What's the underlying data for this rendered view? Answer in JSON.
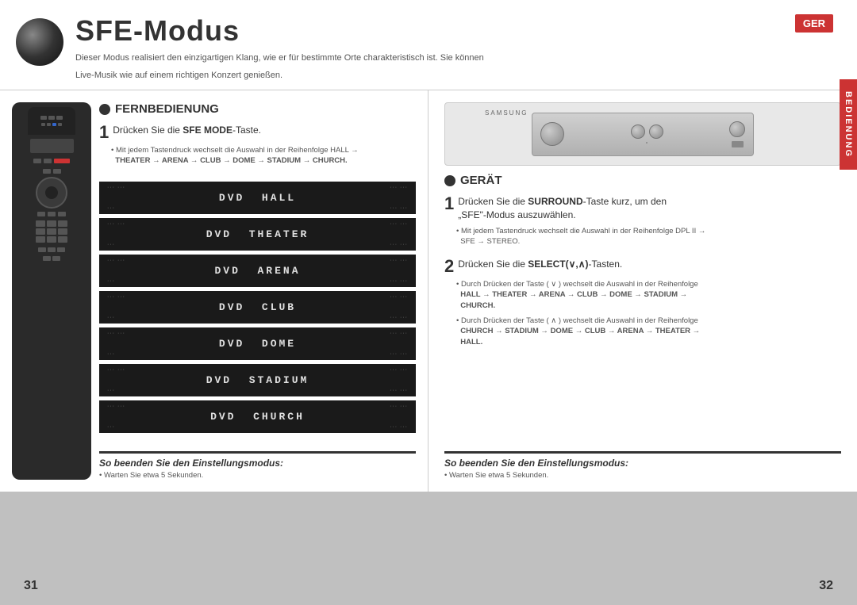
{
  "header": {
    "title": "SFE-Modus",
    "badge": "GER",
    "description_line1": "Dieser Modus realisiert den einzigartigen Klang, wie er für bestimmte Orte charakteristisch ist. Sie können",
    "description_line2": "Live-Musik wie auf einem richtigen Konzert genießen."
  },
  "left_section": {
    "title": "FERNBEDIENUNG",
    "step1_label": "1",
    "step1_text": "Drücken Sie die ",
    "step1_bold": "SFE MODE",
    "step1_suffix": "-Taste.",
    "step1_sub": "• Mit jedem Tastendruck wechselt die Auswahl in der Reihenfolge HALL →\n  THEATER → ARENA → CLUB → DOME → STADIUM → CHURCH.",
    "dvd_panels": [
      {
        "text": "DVD  HALL",
        "dots": "···",
        "sub": "···  ···"
      },
      {
        "text": "DVD  THEATER",
        "dots": "···",
        "sub": "···  ···"
      },
      {
        "text": "DVD  ARENA",
        "dots": "···",
        "sub": "···  ···"
      },
      {
        "text": "DVD  CLUB",
        "dots": "···",
        "sub": "···  ···"
      },
      {
        "text": "DVD  DOME",
        "dots": "···",
        "sub": "···  ···"
      },
      {
        "text": "DVD  STADIUM",
        "dots": "···",
        "sub": "···  ···"
      },
      {
        "text": "DVD  CHURCH",
        "dots": "···",
        "sub": "···  ···"
      }
    ],
    "so_beenden_title": "So beenden Sie den Einstellungsmodus:",
    "so_beenden_sub": "• Warten Sie etwa 5 Sekunden."
  },
  "right_section": {
    "title": "GERÄT",
    "step1_label": "1",
    "step1_text": "Drücken Sie die ",
    "step1_bold": "SURROUND",
    "step1_suffix": "-Taste kurz, um den\n„SFE\"-Modus auszuwählen.",
    "step1_sub": "• Mit jedem Tastendruck wechselt die Auswahl in der Reihenfolge DPL II →\n  SFE → STEREO.",
    "step2_label": "2",
    "step2_text": "Drücken Sie die ",
    "step2_bold": "SELECT(∨,∧)",
    "step2_suffix": "-Tasten.",
    "step2_sub1": "• Durch Drücken der Taste ( ∨ ) wechselt die Auswahl in der Reihenfolge\n  HALL → THEATER → ARENA → CLUB → DOME → STADIUM →\n  CHURCH.",
    "step2_sub2": "• Durch Drücken der Taste ( ∧ ) wechselt die Auswahl in der Reihenfolge\n  CHURCH → STADIUM → DOME → CLUB → ARENA → THEATER →\n  HALL.",
    "so_beenden_title": "So beenden Sie den Einstellungsmodus:",
    "so_beenden_sub": "• Warten Sie etwa 5 Sekunden."
  },
  "footer": {
    "page_left": "31",
    "page_right": "32",
    "bedienung": "BEDIENUNG"
  },
  "device": {
    "brand": "SAMSUNG"
  }
}
